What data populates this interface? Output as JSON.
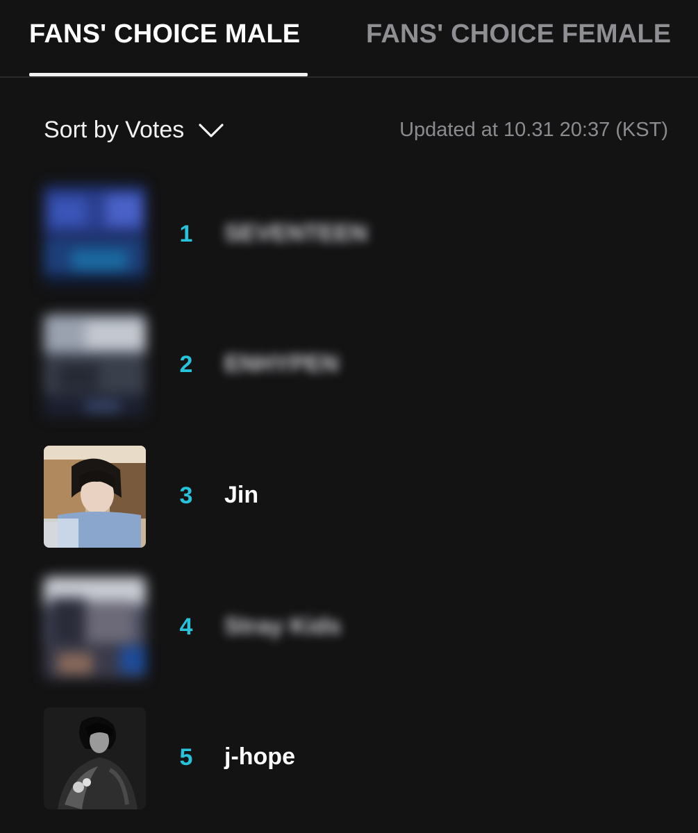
{
  "tabs": [
    {
      "label": "FANS' CHOICE MALE",
      "active": true
    },
    {
      "label": "FANS' CHOICE FEMALE",
      "active": false
    }
  ],
  "sort": {
    "label": "Sort by Votes",
    "icon": "chevron-down-icon"
  },
  "updated": "Updated at 10.31 20:37 (KST)",
  "colors": {
    "background": "#131314",
    "rank": "#27c3da",
    "active_tab": "#ffffff",
    "inactive_tab": "#8e8e93",
    "muted_text": "#8b8b90"
  },
  "ranking": [
    {
      "rank": "1",
      "name": "SEVENTEEN",
      "blurred": true
    },
    {
      "rank": "2",
      "name": "ENHYPEN",
      "blurred": true
    },
    {
      "rank": "3",
      "name": "Jin",
      "blurred": false
    },
    {
      "rank": "4",
      "name": "Stray Kids",
      "blurred": true
    },
    {
      "rank": "5",
      "name": "j-hope",
      "blurred": false
    }
  ]
}
